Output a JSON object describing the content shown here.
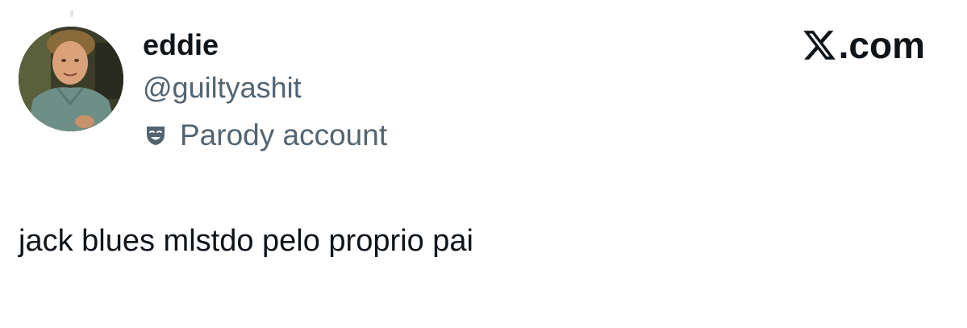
{
  "author": {
    "display_name": "eddie",
    "handle": "@guiltyashit",
    "label_icon": "theater-mask-icon",
    "label_text": "Parody account"
  },
  "brand": {
    "logo_icon": "x-logo-icon",
    "domain_text": ".com"
  },
  "tweet": {
    "text": "jack blues mlstdo pelo proprio pai"
  },
  "colors": {
    "primary_text": "#0f1419",
    "secondary_text": "#536471",
    "background": "#ffffff"
  }
}
